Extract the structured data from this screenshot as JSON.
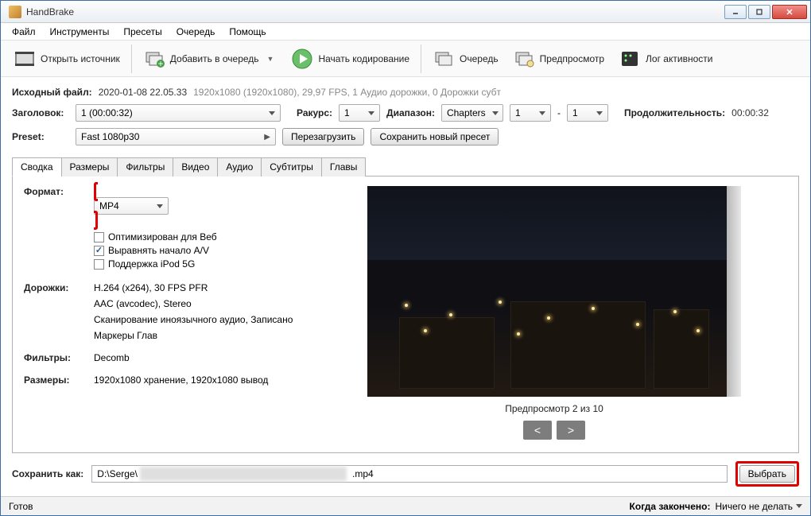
{
  "window": {
    "title": "HandBrake"
  },
  "menu": {
    "items": [
      "Файл",
      "Инструменты",
      "Пресеты",
      "Очередь",
      "Помощь"
    ]
  },
  "toolbar": {
    "open_source": "Открыть источник",
    "add_queue": "Добавить в очередь",
    "start_encode": "Начать кодирование",
    "queue": "Очередь",
    "preview": "Предпросмотр",
    "activity_log": "Лог активности"
  },
  "source": {
    "label": "Исходный файл:",
    "filename": "2020-01-08 22.05.33",
    "info": "1920x1080 (1920x1080), 29,97 FPS, 1 Аудио дорожки, 0 Дорожки субт"
  },
  "title_row": {
    "label": "Заголовок:",
    "title_value": "1  (00:00:32)",
    "angle_label": "Ракурс:",
    "angle_value": "1",
    "range_label": "Диапазон:",
    "range_type": "Chapters",
    "range_from": "1",
    "range_sep": "-",
    "range_to": "1",
    "duration_label": "Продолжительность:",
    "duration_value": "00:00:32"
  },
  "preset_row": {
    "label": "Preset:",
    "value": "Fast 1080p30",
    "reload": "Перезагрузить",
    "save": "Сохранить новый пресет"
  },
  "tabs": [
    "Сводка",
    "Размеры",
    "Фильтры",
    "Видео",
    "Аудио",
    "Субтитры",
    "Главы"
  ],
  "summary": {
    "format_label": "Формат:",
    "format_value": "MP4",
    "opts": {
      "web": "Оптимизирован для Веб",
      "align": "Выравнять начало A/V",
      "ipod": "Поддержка iPod 5G"
    },
    "tracks_label": "Дорожки:",
    "track_video": "H.264 (x264), 30 FPS PFR",
    "track_audio": "AAC (avcodec), Stereo",
    "track_scan": "Сканирование иноязычного аудио, Записано",
    "track_chapters": "Маркеры Глав",
    "filters_label": "Фильтры:",
    "filters_value": "Decomb",
    "sizes_label": "Размеры:",
    "sizes_value": "1920x1080 хранение, 1920x1080 вывод",
    "preview_label": "Предпросмотр 2 из 10"
  },
  "save": {
    "label": "Сохранить как:",
    "path_prefix": "D:\\Serge\\",
    "path_suffix": ".mp4",
    "browse": "Выбрать"
  },
  "status": {
    "ready": "Готов",
    "when_done_label": "Когда закончено:",
    "when_done_value": "Ничего не делать"
  }
}
